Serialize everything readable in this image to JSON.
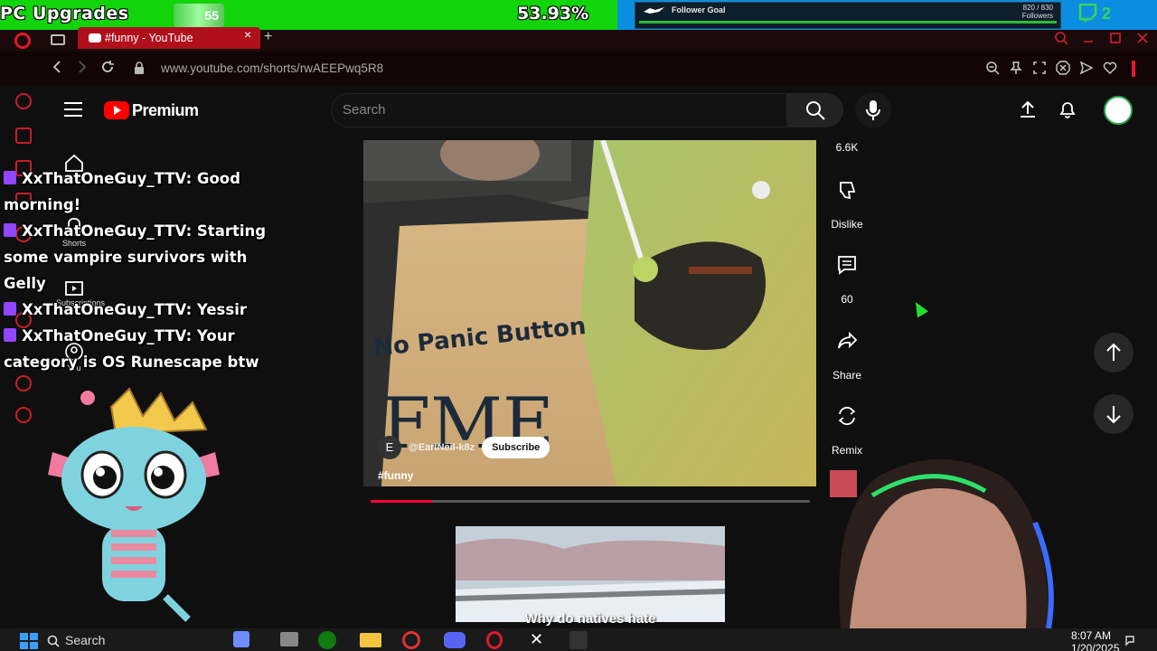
{
  "overlay": {
    "title": "PC Upgrades",
    "badge": "55",
    "percent": "53.93%",
    "follower_goal_label": "Follower Goal",
    "follower_count_line1": "820 / 830",
    "follower_count_line2": "Followers",
    "mini_value": "2"
  },
  "browser": {
    "tab_title": "#funny - YouTube",
    "tab_close": "×",
    "new_tab": "+",
    "url": "www.youtube.com/shorts/rwAEEPwq5R8"
  },
  "youtube": {
    "brand": "Premium",
    "search_placeholder": "Search",
    "nav": [
      {
        "label": "Home"
      },
      {
        "label": "Shorts"
      },
      {
        "label": "Subscriptions"
      },
      {
        "label": "You"
      }
    ],
    "video": {
      "shirt_text_1": "No Panic Button",
      "shirt_text_2": "FME",
      "channel_initial": "E",
      "channel_handle": "@EarlNeil-k8z",
      "subscribe_label": "Subscribe",
      "hashtag": "#funny",
      "progress": 0.14
    },
    "actions": {
      "like_count": "6.6K",
      "dislike_label": "Dislike",
      "comments_count": "60",
      "share_label": "Share",
      "remix_label": "Remix"
    },
    "next_video_caption": "Why do natives hate"
  },
  "chat": [
    {
      "user": "XxThatOneGuy_TTV",
      "message": "Good morning!"
    },
    {
      "user": "XxThatOneGuy_TTV",
      "message": "Starting some vampire survivors with Gelly"
    },
    {
      "user": "XxThatOneGuy_TTV",
      "message": "Yessir"
    },
    {
      "user": "XxThatOneGuy_TTV",
      "message": "Your category is OS Runescape btw"
    }
  ],
  "taskbar": {
    "search_label": "Search",
    "time": "8:07 AM",
    "date": "1/20/2025"
  },
  "colors": {
    "overlay_green": "#12d40a",
    "overlay_blue": "#0a8fe0",
    "yt_red": "#ff0000",
    "opera_red": "#c81e2a",
    "twitch_purple": "#9146ff"
  }
}
